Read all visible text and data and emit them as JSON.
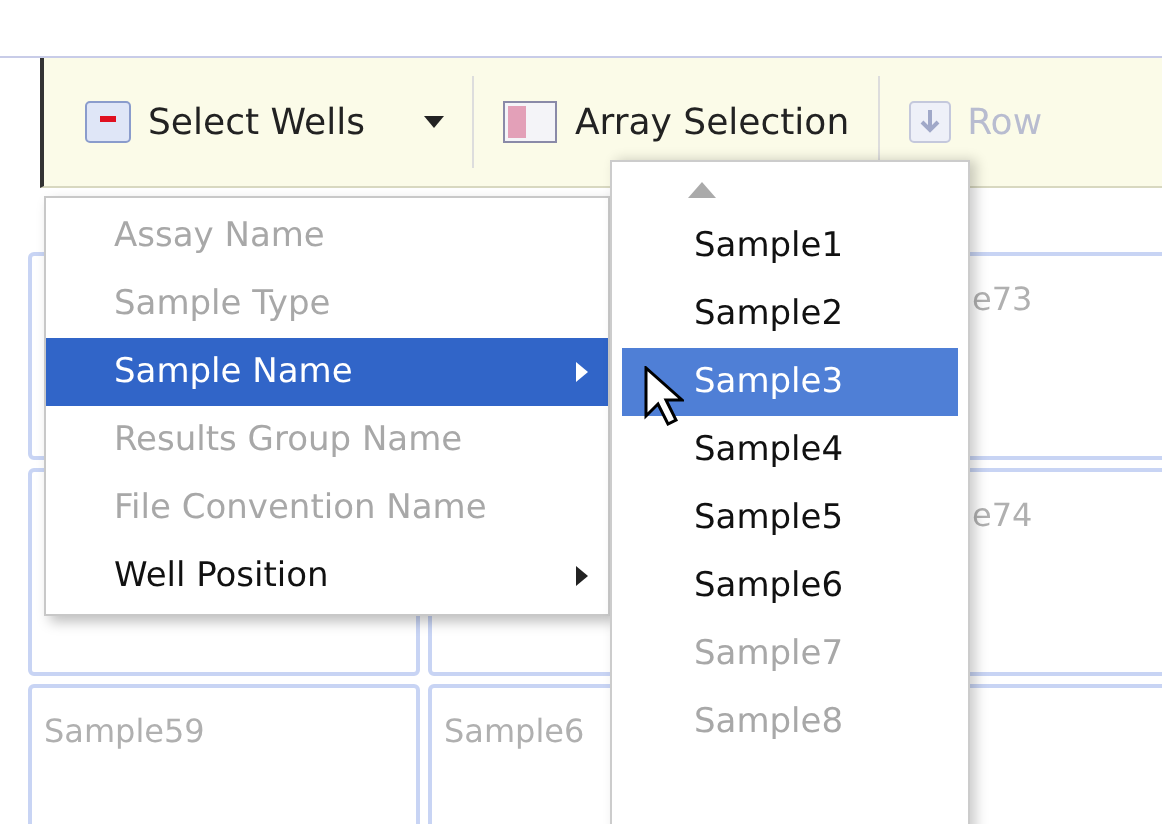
{
  "toolbar": {
    "buttons": [
      {
        "kind": "select",
        "label": "Select Wells",
        "disabled": false
      },
      {
        "kind": "array",
        "label": "Array Selection",
        "disabled": false
      },
      {
        "kind": "row",
        "label": "Row",
        "disabled": true
      }
    ]
  },
  "grid": {
    "cells": [
      "",
      "",
      "e73",
      "",
      "",
      "e74",
      "Sample59",
      "Sample6",
      ""
    ]
  },
  "menu": {
    "items": [
      {
        "label": "Assay Name",
        "disabled": true,
        "selected": false,
        "submenu": false
      },
      {
        "label": "Sample Type",
        "disabled": true,
        "selected": false,
        "submenu": false
      },
      {
        "label": "Sample Name",
        "disabled": false,
        "selected": true,
        "submenu": true
      },
      {
        "label": "Results Group Name",
        "disabled": true,
        "selected": false,
        "submenu": false
      },
      {
        "label": "File Convention Name",
        "disabled": true,
        "selected": false,
        "submenu": false
      },
      {
        "label": "Well Position",
        "disabled": false,
        "selected": false,
        "submenu": true
      }
    ]
  },
  "submenu": {
    "items": [
      {
        "label": "Sample1",
        "selected": false,
        "disabled": false
      },
      {
        "label": "Sample2",
        "selected": false,
        "disabled": false
      },
      {
        "label": "Sample3",
        "selected": true,
        "disabled": false
      },
      {
        "label": "Sample4",
        "selected": false,
        "disabled": false
      },
      {
        "label": "Sample5",
        "selected": false,
        "disabled": false
      },
      {
        "label": "Sample6",
        "selected": false,
        "disabled": false
      },
      {
        "label": "Sample7",
        "selected": false,
        "disabled": true
      },
      {
        "label": "Sample8",
        "selected": false,
        "disabled": true
      }
    ]
  }
}
